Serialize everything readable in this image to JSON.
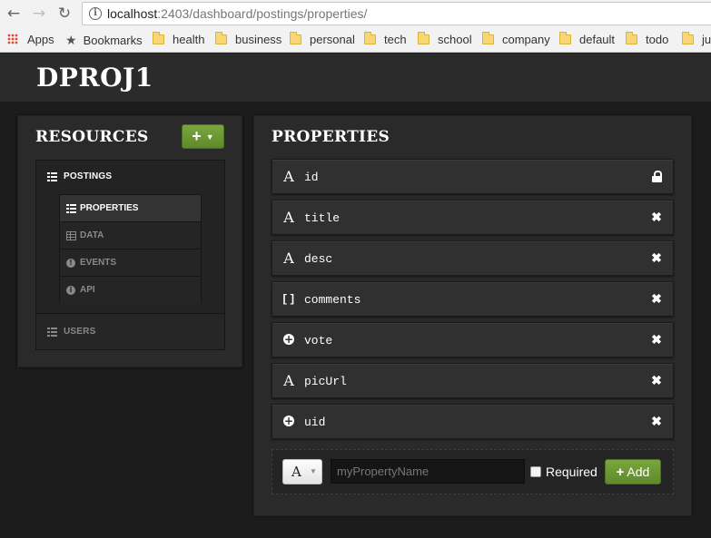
{
  "browser": {
    "url_host": "localhost",
    "url_path": ":2403/dashboard/postings/properties/",
    "back_icon": "arrow-left-icon",
    "forward_icon": "arrow-right-icon",
    "reload_icon": "reload-icon"
  },
  "bookmarks": {
    "apps_label": "Apps",
    "bookmarks_label": "Bookmarks",
    "folders": [
      "health",
      "business",
      "personal",
      "tech",
      "school",
      "company",
      "default",
      "todo",
      "ju"
    ]
  },
  "app": {
    "title": "DPROJ1"
  },
  "resources": {
    "title": "RESOURCES",
    "add_button_label": "+",
    "items": [
      {
        "label": "POSTINGS",
        "icon": "list-icon",
        "subitems": [
          {
            "label": "PROPERTIES",
            "icon": "list-icon",
            "active": true
          },
          {
            "label": "DATA",
            "icon": "table-icon",
            "active": false
          },
          {
            "label": "EVENTS",
            "icon": "exclamation-circle-icon",
            "active": false
          },
          {
            "label": "API",
            "icon": "info-circle-icon",
            "active": false
          }
        ]
      },
      {
        "label": "USERS",
        "icon": "list-icon"
      }
    ]
  },
  "properties": {
    "title": "PROPERTIES",
    "rows": [
      {
        "type_symbol": "A",
        "type": "string",
        "name": "id",
        "action": "lock"
      },
      {
        "type_symbol": "A",
        "type": "string",
        "name": "title",
        "action": "remove"
      },
      {
        "type_symbol": "A",
        "type": "string",
        "name": "desc",
        "action": "remove"
      },
      {
        "type_symbol": "[]",
        "type": "array",
        "name": "comments",
        "action": "remove"
      },
      {
        "type_symbol": "+",
        "type": "number",
        "name": "vote",
        "action": "remove"
      },
      {
        "type_symbol": "A",
        "type": "string",
        "name": "picUrl",
        "action": "remove"
      },
      {
        "type_symbol": "+",
        "type": "number",
        "name": "uid",
        "action": "remove"
      }
    ],
    "remove_glyph": "✖",
    "add_form": {
      "type_symbol": "A",
      "name_placeholder": "myPropertyName",
      "required_label": "Required",
      "required_checked": false,
      "add_button_label": "Add"
    }
  },
  "colors": {
    "accent_green": "#6b9a34",
    "background": "#1c1c1c",
    "panel": "#2a2a2a"
  }
}
